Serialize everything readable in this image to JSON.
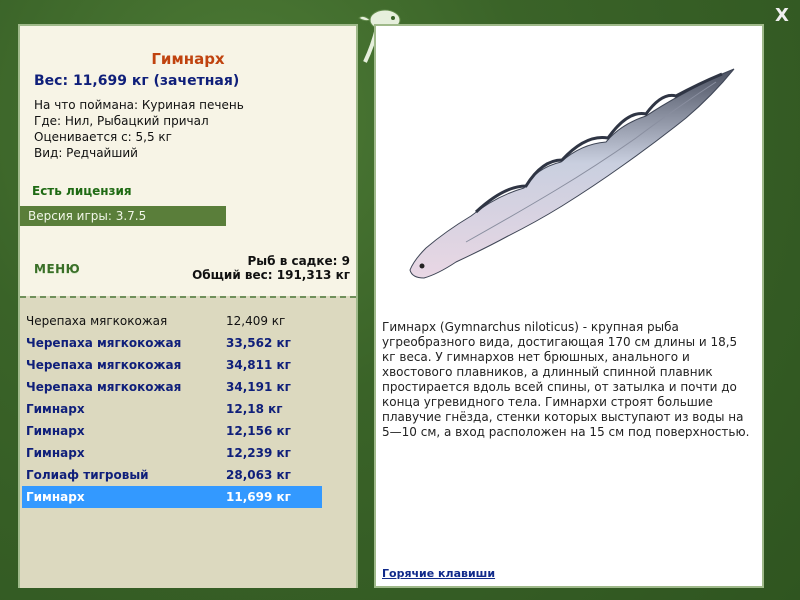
{
  "fish": {
    "name": "Гимнарх",
    "weight_line": "Вес: 11,699 кг (зачетная)",
    "bait": "На что поймана: Куриная печень",
    "location": "Где: Нил, Рыбацкий причал",
    "valued_from": "Оценивается с: 5,5 кг",
    "rarity": "Вид: Редчайший"
  },
  "license_text": "Есть лицензия",
  "version_text": "Версия игры: 3.7.5",
  "menu_label": "МЕНЮ",
  "stats": {
    "fish_count": "Рыб в садке: 9",
    "total_weight": "Общий вес: 191,313 кг"
  },
  "catch": [
    {
      "name": "Черепаха мягкокожая",
      "weight": "12,409 кг"
    },
    {
      "name": "Черепаха мягкокожая",
      "weight": "33,562 кг"
    },
    {
      "name": "Черепаха мягкокожая",
      "weight": "34,811 кг"
    },
    {
      "name": "Черепаха мягкокожая",
      "weight": "34,191 кг"
    },
    {
      "name": "Гимнарх",
      "weight": "12,18 кг"
    },
    {
      "name": "Гимнарх",
      "weight": "12,156 кг"
    },
    {
      "name": "Гимнарх",
      "weight": "12,239 кг"
    },
    {
      "name": "Голиаф тигровый",
      "weight": "28,063 кг"
    },
    {
      "name": "Гимнарх",
      "weight": "11,699 кг"
    }
  ],
  "description": "Гимнарх (Gymnarchus niloticus) - крупная рыба угреобразного вида, достигающая 170 см длины и 18,5 кг веса. У гимнархов нет брюшных, анального и хвостового плавников, а длинный спинной плавник простирается вдоль всей спины, от затылка и почти до конца угревидного тела. Гимнархи строят большие плавучие гнёзда, стенки которых выступают из воды на 5—10 см, а вход расположен на 15 см под поверхностью.",
  "hotkeys_label": "Горячие клавиши",
  "close_label": "X",
  "colors": {
    "frame_green": "#3f6a2c",
    "title_orange": "#c0430f",
    "text_navy": "#0f1f7a",
    "license_green": "#1f6a14",
    "version_bar": "#5a7e3a",
    "selection_blue": "#3399ff"
  },
  "icons": {
    "logo": "fish-logo-icon",
    "close": "close-icon",
    "fish_image": "eel-fish-illustration"
  }
}
